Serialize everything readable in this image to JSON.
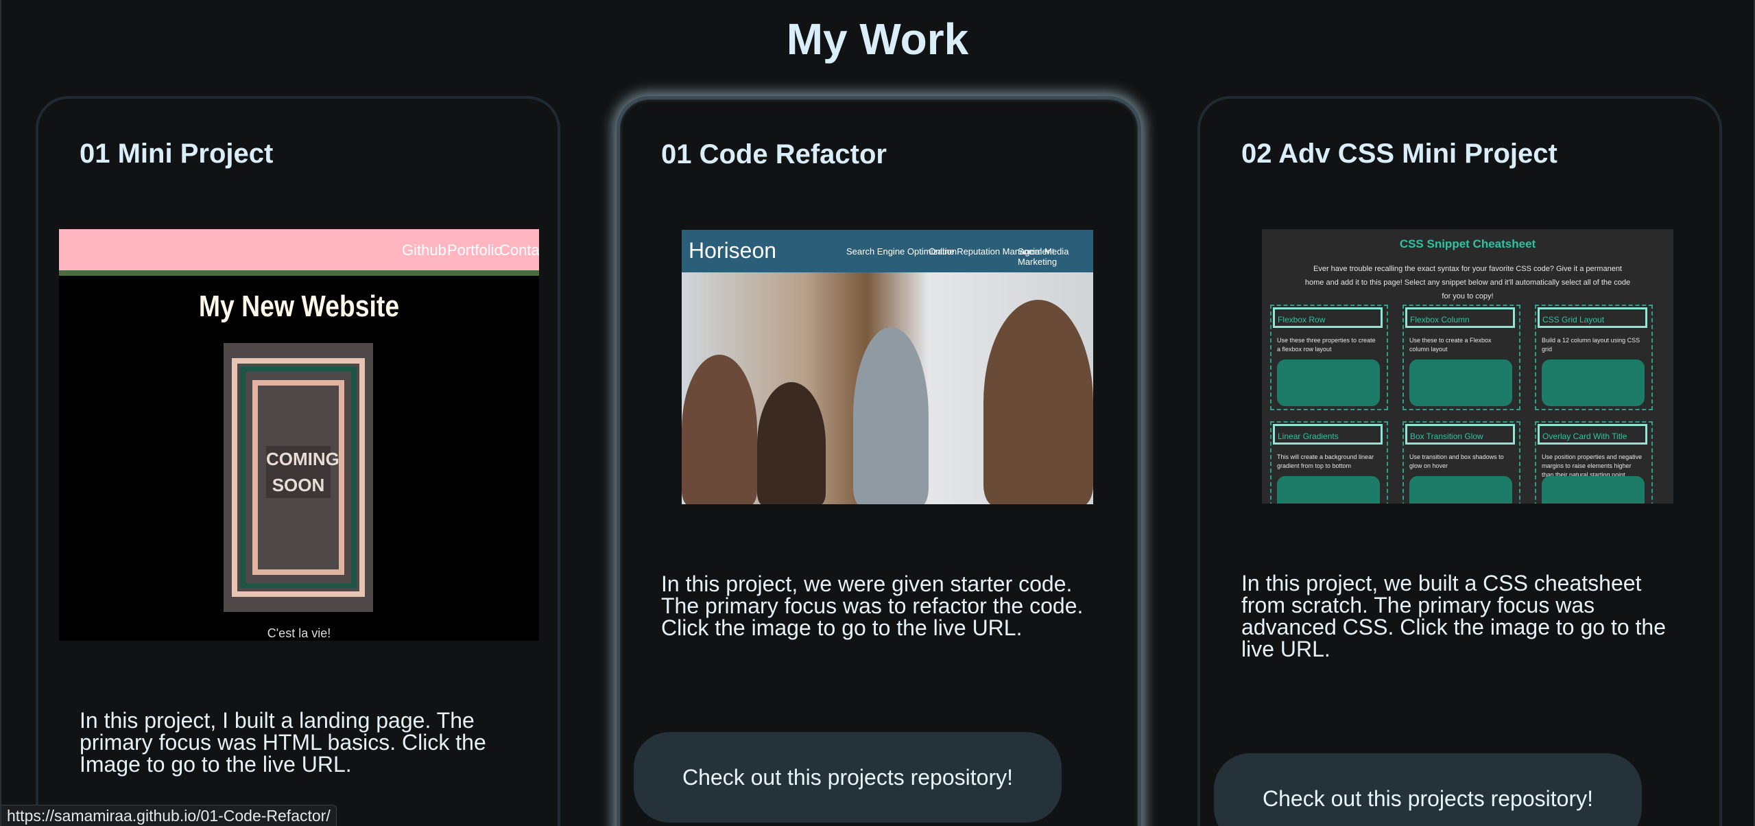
{
  "page": {
    "title": "My Work"
  },
  "cards": [
    {
      "title": "01 Mini Project",
      "description": "In this project, I built a landing page. The primary focus was HTML basics. Click the Image to go to the live URL.",
      "screenshot": {
        "nav_links": [
          "Github",
          "Portfolio",
          "Contact"
        ],
        "heading": "My New Website",
        "poster_text": "COMING SOON",
        "footer_text": "C'est la vie!"
      }
    },
    {
      "title": "01 Code Refactor",
      "description": "In this project, we were given starter code. The primary focus was to refactor the code. Click the image to go to the live URL.",
      "button_label": "Check out this projects repository!",
      "screenshot": {
        "logo": "Horiseon",
        "nav_links": [
          "Search Engine Optimization",
          "Online Reputation Management",
          "Social Media Marketing"
        ]
      }
    },
    {
      "title": "02 Adv CSS Mini Project",
      "description": "In this project, we built a CSS cheatsheet from scratch. The primary focus was advanced CSS. Click the image to go to the live URL.",
      "button_label": "Check out this projects repository!",
      "screenshot": {
        "title": "CSS Snippet Cheatsheet",
        "intro": "Ever have trouble recalling the exact syntax for your favorite CSS code? Give it a permanent home and add it to this page! Select any snippet below and it'll automatically select all of the code for you to copy!",
        "cells": [
          {
            "heading": "Flexbox Row",
            "text": "Use these three properties to create a flexbox row layout"
          },
          {
            "heading": "Flexbox Column",
            "text": "Use these to create a Flexbox column layout"
          },
          {
            "heading": "CSS Grid Layout",
            "text": "Build a 12 column layout using CSS grid"
          },
          {
            "heading": "Linear Gradients",
            "text": "This will create a background linear gradient from top to bottom"
          },
          {
            "heading": "Box Transition Glow",
            "text": "Use transition and box shadows to glow on hover"
          },
          {
            "heading": "Overlay Card With Title",
            "text": "Use position properties and negative margins to raise elements higher than their natural starting point"
          }
        ]
      }
    }
  ],
  "status_bar": {
    "url": "https://samamiraa.github.io/01-Code-Refactor/"
  },
  "colors": {
    "background": "#111213",
    "heading": "#d9eef8",
    "button_bg": "#25323a",
    "card_glow": "#bee1f0"
  }
}
